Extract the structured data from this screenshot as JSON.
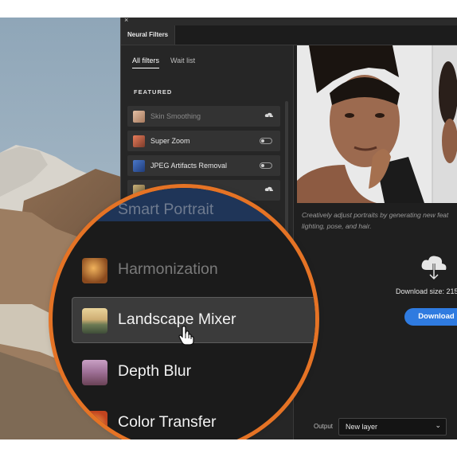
{
  "panel": {
    "close_glyph": "×",
    "tab_label": "Neural Filters"
  },
  "filters": {
    "tabs": [
      {
        "label": "All filters",
        "active": true
      },
      {
        "label": "Wait list",
        "active": false
      }
    ],
    "section_label": "FEATURED",
    "items": [
      {
        "label": "Skin Smoothing",
        "control": "cloud-download-icon",
        "dim": true
      },
      {
        "label": "Super Zoom",
        "control": "toggle-off"
      },
      {
        "label": "JPEG Artifacts Removal",
        "control": "toggle-off"
      },
      {
        "label": "",
        "control": "cloud-download-icon"
      }
    ]
  },
  "magnifier": {
    "header_label": "Smart Portrait",
    "items": [
      {
        "label": "Harmonization",
        "dim": true
      },
      {
        "label": "Landscape Mixer",
        "selected": true
      },
      {
        "label": "Depth Blur"
      },
      {
        "label": "Color Transfer"
      }
    ],
    "ring_color": "#e57325"
  },
  "detail": {
    "description_line1": "Creatively adjust portraits by generating new feat",
    "description_line2": "lighting, pose, and hair.",
    "download_size": "Download size: 215",
    "download_button": "Download",
    "output_label": "Output",
    "output_value": "New layer",
    "accent_color": "#2f7be0"
  }
}
